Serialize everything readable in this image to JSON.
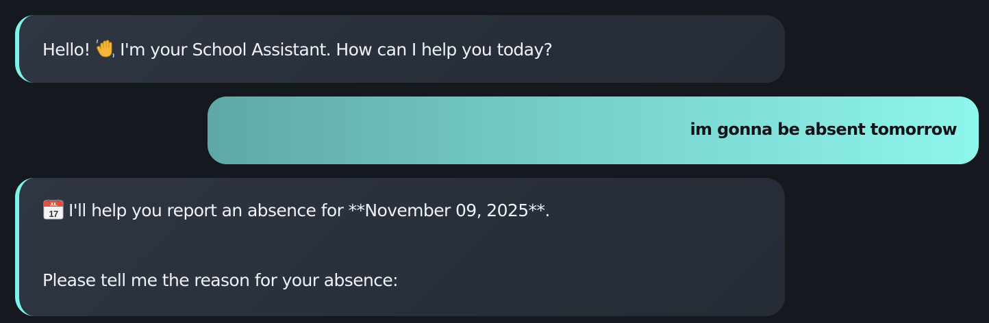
{
  "messages": [
    {
      "role": "assistant",
      "icon": "waving-hand-icon",
      "pre_icon_text": "Hello! ",
      "text": "I'm your School Assistant. How can I help you today?"
    },
    {
      "role": "user",
      "text": "im gonna be absent tomorrow"
    },
    {
      "role": "assistant",
      "icon": "calendar-icon",
      "calendar_month": "JUL",
      "calendar_day": "17",
      "text_line_1": "I'll help you report an absence for **November 09, 2025**.",
      "text_line_2": "Please tell me the reason for your absence:"
    }
  ],
  "colors": {
    "background": "#15181e",
    "assistant_bubble": "#2c333e",
    "assistant_accent": "#7cf2e8",
    "user_gradient_start": "#5fa8a6",
    "user_gradient_end": "#8ef6ed"
  }
}
